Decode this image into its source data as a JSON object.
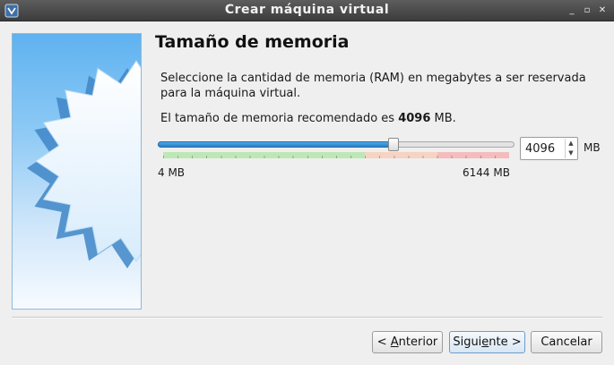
{
  "window": {
    "title": "Crear máquina virtual",
    "controls": {
      "minimize": "_",
      "maximize": "▫",
      "close": "✕"
    }
  },
  "page": {
    "heading": "Tamaño de memoria",
    "description": "Seleccione la cantidad de memoria (RAM) en megabytes a ser reservada para la máquina virtual.",
    "recommended_prefix": "El tamaño de memoria recomendado es ",
    "recommended_value": "4096",
    "recommended_suffix": " MB."
  },
  "memory": {
    "min_label": "4 MB",
    "max_label": "6144 MB",
    "min": 4,
    "max": 6144,
    "value": 4096,
    "value_text": "4096",
    "unit": "MB",
    "zones": [
      {
        "color": "green",
        "from": 4,
        "to": 3584
      },
      {
        "color": "orange",
        "from": 3584,
        "to": 4864
      },
      {
        "color": "red",
        "from": 4864,
        "to": 6144
      }
    ],
    "colors": {
      "green": "#bde8b5",
      "orange": "#f6d3c2",
      "red": "#f4bcbc",
      "fill": "#2a7fc4"
    }
  },
  "buttons": {
    "back": {
      "pre": "< ",
      "mnemonic": "A",
      "post": "nterior"
    },
    "next": {
      "pre": "Sigui",
      "mnemonic": "e",
      "post": "nte >"
    },
    "cancel": "Cancelar"
  },
  "icons": {
    "app": "virtualbox-icon",
    "wizard_art": "starburst-illustration"
  }
}
